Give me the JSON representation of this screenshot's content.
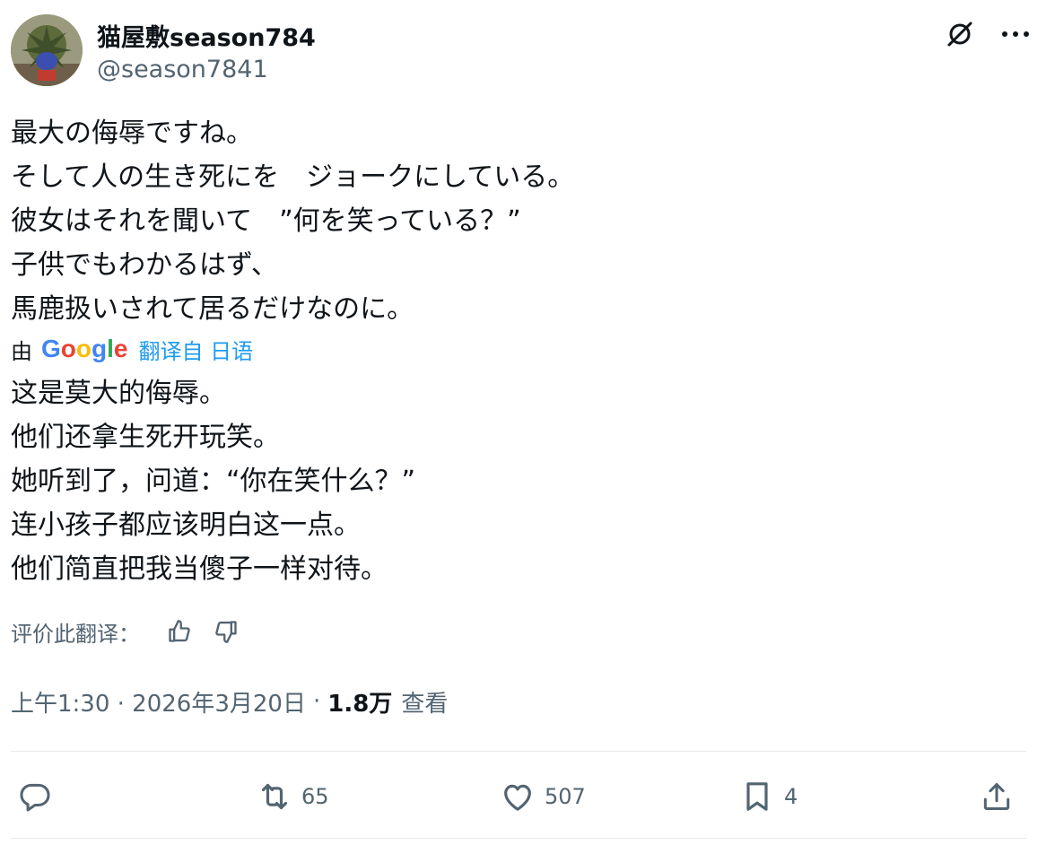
{
  "author": {
    "display_name": "猫屋敷season784",
    "handle": "@season7841"
  },
  "post": {
    "original_lines": [
      "最大の侮辱ですね。",
      "そして人の生き死にを　ジョークにしている。",
      "彼女はそれを聞いて　”何を笑っている？”",
      "子供でもわかるはず、",
      "馬鹿扱いされて居るだけなのに。"
    ],
    "translation": {
      "by_label": "由",
      "provider": "Google",
      "from_label": "翻译自 日语",
      "lines": [
        "这是莫大的侮辱。",
        "他们还拿生死开玩笑。",
        "她听到了，问道：“你在笑什么？”",
        "连小孩子都应该明白这一点。",
        "他们简直把我当傻子一样对待。"
      ]
    },
    "rate_label": "评价此翻译：",
    "timestamp": "上午1:30 · 2026年3月20日",
    "separator": "·",
    "views_count": "1.8万",
    "views_label": "查看"
  },
  "actions": {
    "reply": {
      "icon": "reply-icon",
      "count": ""
    },
    "repost": {
      "icon": "repost-icon",
      "count": "65"
    },
    "like": {
      "icon": "heart-icon",
      "count": "507"
    },
    "bookmark": {
      "icon": "bookmark-icon",
      "count": "4"
    },
    "share": {
      "icon": "share-icon",
      "count": ""
    }
  },
  "colors": {
    "text": "#0f1419",
    "secondary": "#536471",
    "link": "#1d9bf0",
    "divider": "#e6e9ec",
    "google_blue": "#4285f4",
    "google_red": "#ea4335",
    "google_yellow": "#fbbc05",
    "google_green": "#34a853"
  }
}
